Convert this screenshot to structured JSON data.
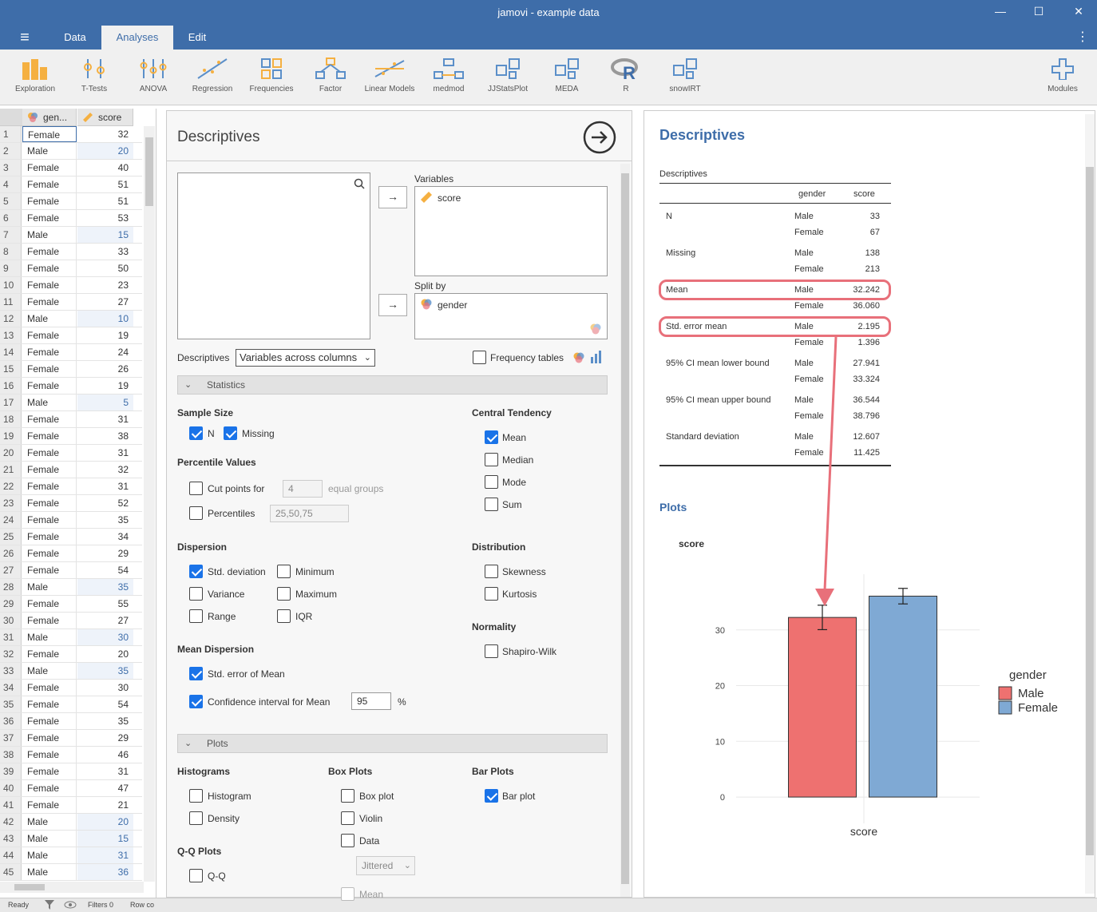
{
  "window": {
    "title": "jamovi - example data",
    "minimize": "—",
    "maximize": "☐",
    "close": "✕"
  },
  "menu": {
    "hamburger": "≡",
    "tabs": [
      "Data",
      "Analyses",
      "Edit"
    ],
    "more": "⋮"
  },
  "toolbar": {
    "items": [
      "Exploration",
      "T-Tests",
      "ANOVA",
      "Regression",
      "Frequencies",
      "Factor",
      "Linear Models",
      "medmod",
      "JJStatsPlot",
      "MEDA",
      "R",
      "snowIRT"
    ],
    "modules": "Modules"
  },
  "sheet": {
    "col_gender": "gen...",
    "col_score": "score",
    "rows": [
      [
        "Female",
        32
      ],
      [
        "Male",
        20
      ],
      [
        "Female",
        40
      ],
      [
        "Female",
        51
      ],
      [
        "Female",
        51
      ],
      [
        "Female",
        53
      ],
      [
        "Male",
        15
      ],
      [
        "Female",
        33
      ],
      [
        "Female",
        50
      ],
      [
        "Female",
        23
      ],
      [
        "Female",
        27
      ],
      [
        "Male",
        10
      ],
      [
        "Female",
        19
      ],
      [
        "Female",
        24
      ],
      [
        "Female",
        26
      ],
      [
        "Female",
        19
      ],
      [
        "Male",
        5
      ],
      [
        "Female",
        31
      ],
      [
        "Female",
        38
      ],
      [
        "Female",
        31
      ],
      [
        "Female",
        32
      ],
      [
        "Female",
        31
      ],
      [
        "Female",
        52
      ],
      [
        "Female",
        35
      ],
      [
        "Female",
        34
      ],
      [
        "Female",
        29
      ],
      [
        "Female",
        54
      ],
      [
        "Male",
        35
      ],
      [
        "Female",
        55
      ],
      [
        "Female",
        27
      ],
      [
        "Male",
        30
      ],
      [
        "Female",
        20
      ],
      [
        "Male",
        35
      ],
      [
        "Female",
        30
      ],
      [
        "Female",
        54
      ],
      [
        "Female",
        35
      ],
      [
        "Female",
        29
      ],
      [
        "Female",
        46
      ],
      [
        "Female",
        31
      ],
      [
        "Female",
        47
      ],
      [
        "Female",
        21
      ],
      [
        "Male",
        20
      ],
      [
        "Male",
        15
      ],
      [
        "Male",
        31
      ],
      [
        "Male",
        36
      ]
    ]
  },
  "status": {
    "ready": "Ready",
    "filters": "Filters 0",
    "rowcount": "Row co"
  },
  "options": {
    "title": "Descriptives",
    "variables_label": "Variables",
    "variables": [
      "score"
    ],
    "splitby_label": "Split by",
    "splitby": [
      "gender"
    ],
    "descriptives_label": "Descriptives",
    "descriptives_select": "Variables across columns",
    "freq_tables": "Frequency tables",
    "statistics_section": "Statistics",
    "sample_size": "Sample Size",
    "n": "N",
    "missing": "Missing",
    "percentile_values": "Percentile Values",
    "cut_points": "Cut points for",
    "cut_value": "4",
    "equal_groups": "equal groups",
    "percentiles": "Percentiles",
    "percentiles_value": "25,50,75",
    "dispersion": "Dispersion",
    "std_dev": "Std. deviation",
    "minimum": "Minimum",
    "variance": "Variance",
    "maximum": "Maximum",
    "range": "Range",
    "iqr": "IQR",
    "mean_dispersion": "Mean Dispersion",
    "se_mean": "Std. error of Mean",
    "ci_mean": "Confidence interval for Mean",
    "ci_value": "95",
    "percent": "%",
    "central_tendency": "Central Tendency",
    "mean": "Mean",
    "median": "Median",
    "mode": "Mode",
    "sum": "Sum",
    "distribution": "Distribution",
    "skewness": "Skewness",
    "kurtosis": "Kurtosis",
    "normality": "Normality",
    "shapiro": "Shapiro-Wilk",
    "plots_section": "Plots",
    "histograms": "Histograms",
    "histogram": "Histogram",
    "density": "Density",
    "qq_plots": "Q-Q Plots",
    "qq": "Q-Q",
    "box_plots": "Box Plots",
    "box_plot": "Box plot",
    "violin": "Violin",
    "data": "Data",
    "jittered": "Jittered",
    "mean_opt": "Mean",
    "bar_plots": "Bar Plots",
    "bar_plot": "Bar plot"
  },
  "results": {
    "title": "Descriptives",
    "table_title": "Descriptives",
    "col_gender": "gender",
    "col_score": "score",
    "rows": [
      {
        "stat": "N",
        "male": "33",
        "female": "67"
      },
      {
        "stat": "Missing",
        "male": "138",
        "female": "213"
      },
      {
        "stat": "Mean",
        "male": "32.242",
        "female": "36.060"
      },
      {
        "stat": "Std. error mean",
        "male": "2.195",
        "female": "1.396"
      },
      {
        "stat": "95% CI mean lower bound",
        "male": "27.941",
        "female": "33.324"
      },
      {
        "stat": "95% CI mean upper bound",
        "male": "36.544",
        "female": "38.796"
      },
      {
        "stat": "Standard deviation",
        "male": "12.607",
        "female": "11.425"
      }
    ],
    "male_label": "Male",
    "female_label": "Female",
    "plots_title": "Plots",
    "plot_var": "score"
  },
  "chart_data": {
    "type": "bar",
    "title": "score",
    "xlabel": "score",
    "ylabel": "",
    "categories": [
      "Male",
      "Female"
    ],
    "values": [
      32.242,
      36.06
    ],
    "error_low": [
      30.047,
      34.664
    ],
    "error_high": [
      34.437,
      37.456
    ],
    "yticks": [
      0,
      10,
      20,
      30
    ],
    "ylim": [
      -3,
      40
    ],
    "legend_title": "gender",
    "legend": [
      "Male",
      "Female"
    ],
    "colors": [
      "#ee7170",
      "#7fa9d4"
    ],
    "legend_position": "right"
  },
  "colors": {
    "accent": "#3e6da9",
    "highlight": "#e8707a"
  }
}
